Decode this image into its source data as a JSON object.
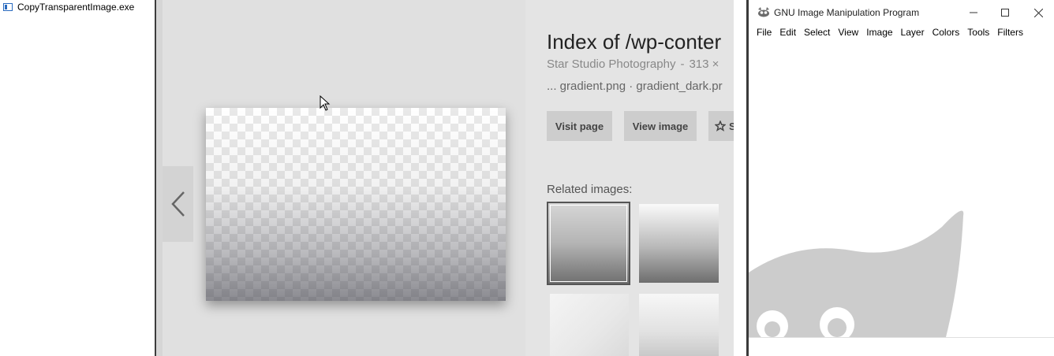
{
  "left_window": {
    "title": "CopyTransparentImage.exe"
  },
  "browser": {
    "result": {
      "title": "Index of /wp-conter",
      "source": "Star Studio Photography",
      "size": "313 ×",
      "files": "... gradient.png · gradient_dark.pr"
    },
    "buttons": {
      "visit": "Visit page",
      "view": "View image",
      "save_partial": "S"
    },
    "related_label": "Related images:"
  },
  "gimp": {
    "title": "GNU Image Manipulation Program",
    "menu": [
      "File",
      "Edit",
      "Select",
      "View",
      "Image",
      "Layer",
      "Colors",
      "Tools",
      "Filters"
    ]
  },
  "colors": {
    "browser_bg": "#e4e4e4",
    "button_bg": "#cdcdcd",
    "wilber_gray": "#cccccc"
  }
}
